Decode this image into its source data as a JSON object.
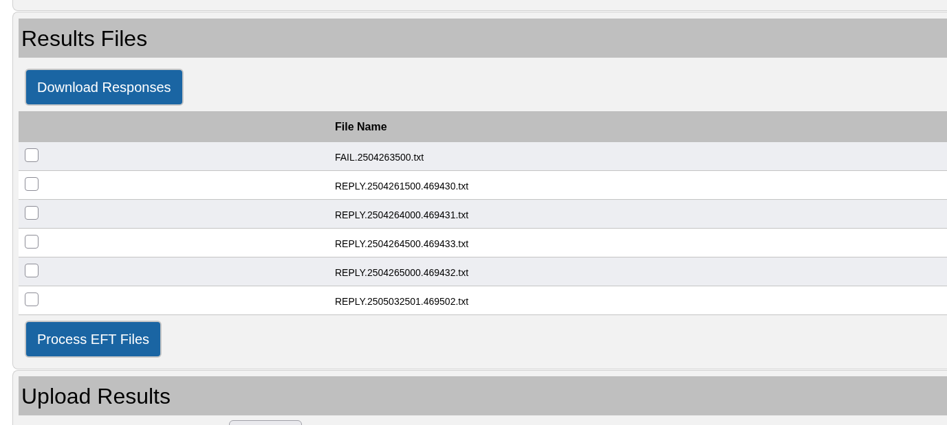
{
  "results_section": {
    "title": "Results Files",
    "download_button": "Download Responses",
    "table": {
      "columns": [
        "File Name"
      ],
      "rows": [
        {
          "checked": false,
          "file_name": "FAIL.2504263500.txt"
        },
        {
          "checked": false,
          "file_name": "REPLY.2504261500.469430.txt"
        },
        {
          "checked": false,
          "file_name": "REPLY.2504264000.469431.txt"
        },
        {
          "checked": false,
          "file_name": "REPLY.2504264500.469433.txt"
        },
        {
          "checked": false,
          "file_name": "REPLY.2504265000.469432.txt"
        },
        {
          "checked": false,
          "file_name": "REPLY.2505032501.469502.txt"
        }
      ]
    },
    "process_button": "Process EFT Files"
  },
  "upload_section": {
    "title": "Upload Results"
  }
}
